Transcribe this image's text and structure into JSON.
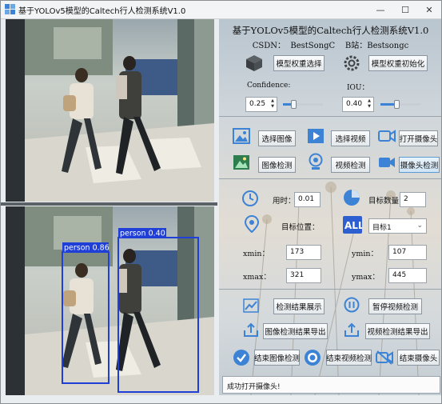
{
  "window": {
    "title": "基于YOLOv5模型的Caltech行人检测系统V1.0",
    "minimize_glyph": "—",
    "maximize_glyph": "☐",
    "close_glyph": "✕"
  },
  "detections": [
    {
      "label": "person 0.86"
    },
    {
      "label": "person 0.40"
    }
  ],
  "header": {
    "title": "基于YOLOv5模型的Caltech行人检测系统V1.0",
    "credits": "CSDN：  BestSongC    B站：Bestsongc"
  },
  "model": {
    "select_weights_label": "模型权重选择",
    "init_weights_label": "模型权重初始化",
    "confidence_label": "Confidence:",
    "confidence_value": "0.25",
    "confidence_fraction": 0.25,
    "iou_label": "IOU：",
    "iou_value": "0.40",
    "iou_fraction": 0.4
  },
  "input": {
    "select_image_label": "选择图像",
    "select_video_label": "选择视频",
    "open_camera_label": "打开摄像头",
    "image_detect_label": "图像检测",
    "video_detect_label": "视频检测",
    "camera_detect_label": "摄像头检测"
  },
  "results": {
    "time_label": "用时：",
    "time_value": "0.01",
    "count_label": "目标数量：",
    "count_value": "2",
    "position_label": "目标位置：",
    "target_select_value": "目标1",
    "xmin_label": "xmin：",
    "xmin_value": "173",
    "ymin_label": "ymin：",
    "ymin_value": "107",
    "xmax_label": "xmax：",
    "xmax_value": "321",
    "ymax_label": "ymax：",
    "ymax_value": "445"
  },
  "actions": {
    "show_results_label": "检测结果展示",
    "pause_video_label": "暂停视频检测",
    "export_image_label": "图像检测结果导出",
    "export_video_label": "视频检测结果导出",
    "stop_image_label": "结束图像检测",
    "stop_video_label": "结束视频检测",
    "stop_camera_label": "结束摄像头"
  },
  "status": {
    "message": "成功打开摄像头!"
  },
  "colors": {
    "accent_blue": "#3c83d6",
    "bbox_blue": "#1f3fd6",
    "icon_dark": "#3f4448"
  }
}
